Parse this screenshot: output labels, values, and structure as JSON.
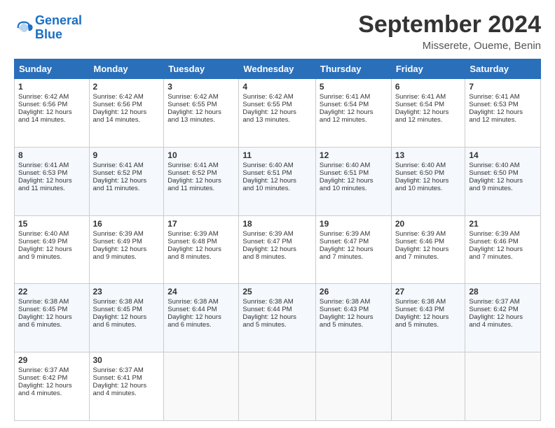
{
  "logo": {
    "text_general": "General",
    "text_blue": "Blue"
  },
  "title": "September 2024",
  "subtitle": "Misserete, Oueme, Benin",
  "header_days": [
    "Sunday",
    "Monday",
    "Tuesday",
    "Wednesday",
    "Thursday",
    "Friday",
    "Saturday"
  ],
  "weeks": [
    [
      {
        "day": "1",
        "sunrise": "6:42 AM",
        "sunset": "6:56 PM",
        "daylight": "12 hours and 14 minutes."
      },
      {
        "day": "2",
        "sunrise": "6:42 AM",
        "sunset": "6:56 PM",
        "daylight": "12 hours and 14 minutes."
      },
      {
        "day": "3",
        "sunrise": "6:42 AM",
        "sunset": "6:55 PM",
        "daylight": "12 hours and 13 minutes."
      },
      {
        "day": "4",
        "sunrise": "6:42 AM",
        "sunset": "6:55 PM",
        "daylight": "12 hours and 13 minutes."
      },
      {
        "day": "5",
        "sunrise": "6:41 AM",
        "sunset": "6:54 PM",
        "daylight": "12 hours and 12 minutes."
      },
      {
        "day": "6",
        "sunrise": "6:41 AM",
        "sunset": "6:54 PM",
        "daylight": "12 hours and 12 minutes."
      },
      {
        "day": "7",
        "sunrise": "6:41 AM",
        "sunset": "6:53 PM",
        "daylight": "12 hours and 12 minutes."
      }
    ],
    [
      {
        "day": "8",
        "sunrise": "6:41 AM",
        "sunset": "6:53 PM",
        "daylight": "12 hours and 11 minutes."
      },
      {
        "day": "9",
        "sunrise": "6:41 AM",
        "sunset": "6:52 PM",
        "daylight": "12 hours and 11 minutes."
      },
      {
        "day": "10",
        "sunrise": "6:41 AM",
        "sunset": "6:52 PM",
        "daylight": "12 hours and 11 minutes."
      },
      {
        "day": "11",
        "sunrise": "6:40 AM",
        "sunset": "6:51 PM",
        "daylight": "12 hours and 10 minutes."
      },
      {
        "day": "12",
        "sunrise": "6:40 AM",
        "sunset": "6:51 PM",
        "daylight": "12 hours and 10 minutes."
      },
      {
        "day": "13",
        "sunrise": "6:40 AM",
        "sunset": "6:50 PM",
        "daylight": "12 hours and 10 minutes."
      },
      {
        "day": "14",
        "sunrise": "6:40 AM",
        "sunset": "6:50 PM",
        "daylight": "12 hours and 9 minutes."
      }
    ],
    [
      {
        "day": "15",
        "sunrise": "6:40 AM",
        "sunset": "6:49 PM",
        "daylight": "12 hours and 9 minutes."
      },
      {
        "day": "16",
        "sunrise": "6:39 AM",
        "sunset": "6:49 PM",
        "daylight": "12 hours and 9 minutes."
      },
      {
        "day": "17",
        "sunrise": "6:39 AM",
        "sunset": "6:48 PM",
        "daylight": "12 hours and 8 minutes."
      },
      {
        "day": "18",
        "sunrise": "6:39 AM",
        "sunset": "6:47 PM",
        "daylight": "12 hours and 8 minutes."
      },
      {
        "day": "19",
        "sunrise": "6:39 AM",
        "sunset": "6:47 PM",
        "daylight": "12 hours and 7 minutes."
      },
      {
        "day": "20",
        "sunrise": "6:39 AM",
        "sunset": "6:46 PM",
        "daylight": "12 hours and 7 minutes."
      },
      {
        "day": "21",
        "sunrise": "6:39 AM",
        "sunset": "6:46 PM",
        "daylight": "12 hours and 7 minutes."
      }
    ],
    [
      {
        "day": "22",
        "sunrise": "6:38 AM",
        "sunset": "6:45 PM",
        "daylight": "12 hours and 6 minutes."
      },
      {
        "day": "23",
        "sunrise": "6:38 AM",
        "sunset": "6:45 PM",
        "daylight": "12 hours and 6 minutes."
      },
      {
        "day": "24",
        "sunrise": "6:38 AM",
        "sunset": "6:44 PM",
        "daylight": "12 hours and 6 minutes."
      },
      {
        "day": "25",
        "sunrise": "6:38 AM",
        "sunset": "6:44 PM",
        "daylight": "12 hours and 5 minutes."
      },
      {
        "day": "26",
        "sunrise": "6:38 AM",
        "sunset": "6:43 PM",
        "daylight": "12 hours and 5 minutes."
      },
      {
        "day": "27",
        "sunrise": "6:38 AM",
        "sunset": "6:43 PM",
        "daylight": "12 hours and 5 minutes."
      },
      {
        "day": "28",
        "sunrise": "6:37 AM",
        "sunset": "6:42 PM",
        "daylight": "12 hours and 4 minutes."
      }
    ],
    [
      {
        "day": "29",
        "sunrise": "6:37 AM",
        "sunset": "6:42 PM",
        "daylight": "12 hours and 4 minutes."
      },
      {
        "day": "30",
        "sunrise": "6:37 AM",
        "sunset": "6:41 PM",
        "daylight": "12 hours and 4 minutes."
      },
      null,
      null,
      null,
      null,
      null
    ]
  ],
  "labels": {
    "sunrise": "Sunrise:",
    "sunset": "Sunset:",
    "daylight": "Daylight:"
  }
}
